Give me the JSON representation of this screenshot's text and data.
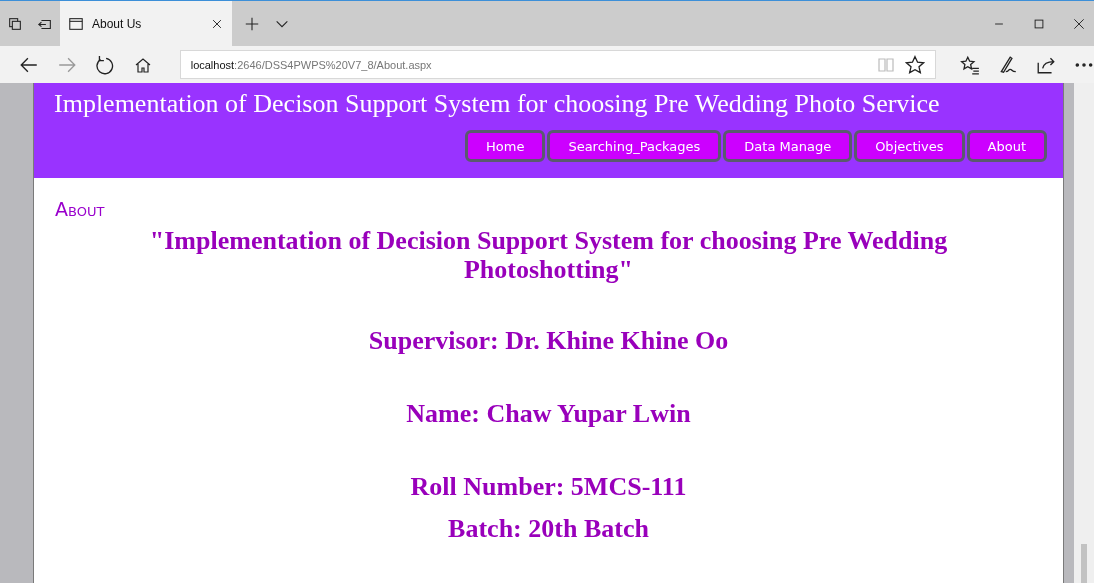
{
  "browser": {
    "tab_title": "About Us",
    "address_host": "localhost",
    "address_path": ":2646/DSS4PWPS%20V7_8/About.aspx"
  },
  "site": {
    "title": "Implementation of Decison Support System for choosing Pre Wedding Photo Service",
    "nav": [
      "Home",
      "Searching_Packages",
      "Data Manage",
      "Objectives",
      "About"
    ]
  },
  "content": {
    "heading": "About",
    "lines": [
      "\"Implementation of Decision Support System for choosing Pre Wedding Photoshotting\"",
      "Supervisor: Dr. Khine Khine Oo",
      "Name: Chaw Yupar Lwin",
      "Roll Number: 5MCS-111",
      "Batch: 20th Batch"
    ]
  }
}
